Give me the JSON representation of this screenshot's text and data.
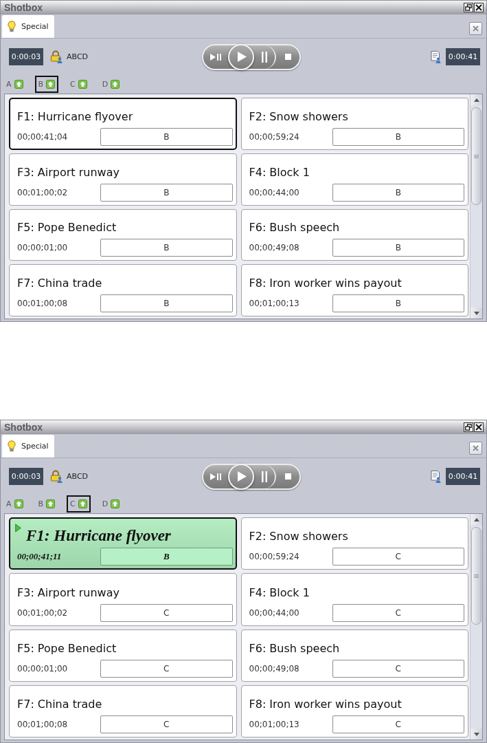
{
  "panels": [
    {
      "window": {
        "title": "Shotbox"
      },
      "tabs": [
        {
          "label": "Special",
          "selected": true
        }
      ],
      "toolbar": {
        "elapsed": "0:00:03",
        "lock_label": "ABCD",
        "remaining": "0:00:41"
      },
      "banks": [
        {
          "label": "A",
          "selected": false
        },
        {
          "label": "B",
          "selected": true
        },
        {
          "label": "C",
          "selected": false
        },
        {
          "label": "D",
          "selected": false
        }
      ],
      "cues": [
        {
          "title": "F1: Hurricane flyover",
          "timecode": "00;00;41;04",
          "bank": "B",
          "selected": true,
          "playing": false
        },
        {
          "title": "F2: Snow showers",
          "timecode": "00;00;59;24",
          "bank": "B",
          "selected": false,
          "playing": false
        },
        {
          "title": "F3: Airport runway",
          "timecode": "00;01;00;02",
          "bank": "B",
          "selected": false,
          "playing": false
        },
        {
          "title": "F4: Block 1",
          "timecode": "00;00;44;00",
          "bank": "B",
          "selected": false,
          "playing": false
        },
        {
          "title": "F5: Pope Benedict",
          "timecode": "00;00;01;00",
          "bank": "B",
          "selected": false,
          "playing": false
        },
        {
          "title": "F6: Bush speech",
          "timecode": "00;00;49;08",
          "bank": "B",
          "selected": false,
          "playing": false
        },
        {
          "title": "F7: China trade",
          "timecode": "00;01;00;08",
          "bank": "B",
          "selected": false,
          "playing": false
        },
        {
          "title": "F8: Iron worker wins payout",
          "timecode": "00;01;00;13",
          "bank": "B",
          "selected": false,
          "playing": false
        }
      ]
    },
    {
      "window": {
        "title": "Shotbox"
      },
      "tabs": [
        {
          "label": "Special",
          "selected": true
        }
      ],
      "toolbar": {
        "elapsed": "0:00:03",
        "lock_label": "ABCD",
        "remaining": "0:00:41"
      },
      "banks": [
        {
          "label": "A",
          "selected": false
        },
        {
          "label": "B",
          "selected": false
        },
        {
          "label": "C",
          "selected": true
        },
        {
          "label": "D",
          "selected": false
        }
      ],
      "cues": [
        {
          "title": "F1: Hurricane flyover",
          "timecode": "00;00;41;11",
          "bank": "B",
          "selected": true,
          "playing": true
        },
        {
          "title": "F2: Snow showers",
          "timecode": "00;00;59;24",
          "bank": "C",
          "selected": false,
          "playing": false
        },
        {
          "title": "F3: Airport runway",
          "timecode": "00;01;00;02",
          "bank": "C",
          "selected": false,
          "playing": false
        },
        {
          "title": "F4: Block 1",
          "timecode": "00;00;44;00",
          "bank": "C",
          "selected": false,
          "playing": false
        },
        {
          "title": "F5: Pope Benedict",
          "timecode": "00;00;01;00",
          "bank": "C",
          "selected": false,
          "playing": false
        },
        {
          "title": "F6: Bush speech",
          "timecode": "00;00;49;08",
          "bank": "C",
          "selected": false,
          "playing": false
        },
        {
          "title": "F7: China trade",
          "timecode": "00;01;00;08",
          "bank": "C",
          "selected": false,
          "playing": false
        },
        {
          "title": "F8: Iron worker wins payout",
          "timecode": "00;01;00;13",
          "bank": "C",
          "selected": false,
          "playing": false
        }
      ]
    }
  ]
}
